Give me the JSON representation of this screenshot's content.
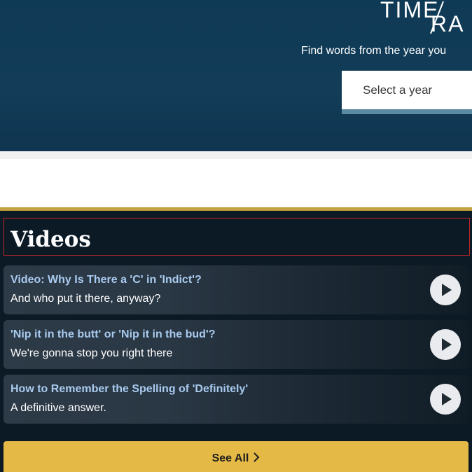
{
  "hero": {
    "logo_line1": "TIME",
    "logo_line2": "RA",
    "tagline": "Find words from the year you",
    "year_select_placeholder": "Select a year"
  },
  "videos": {
    "heading": "Videos",
    "items": [
      {
        "title": "Video: Why Is There a 'C' in 'Indict'?",
        "subtitle": "And who put it there, anyway?"
      },
      {
        "title": "'Nip it in the butt' or 'Nip it in the bud'?",
        "subtitle": "We're gonna stop you right there"
      },
      {
        "title": "How to Remember the Spelling of 'Definitely'",
        "subtitle": "A definitive answer."
      }
    ],
    "see_all_label": "See All"
  },
  "colors": {
    "hero_bg": "#123c58",
    "accent_gold": "#e4b946",
    "video_title": "#a9cbef",
    "section_bg": "#0c1a25"
  },
  "icons": {
    "play": "play-icon",
    "see_all": "chevron-right-icon"
  }
}
